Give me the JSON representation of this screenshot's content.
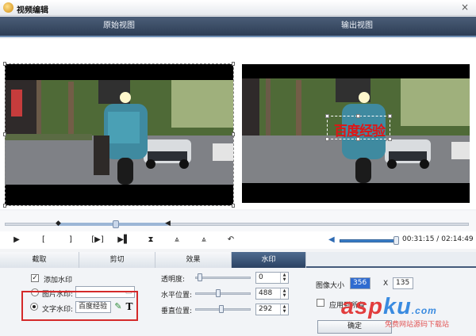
{
  "window": {
    "title": "视频编辑",
    "close_glyph": "×"
  },
  "preview": {
    "original_label": "原始视图",
    "output_label": "输出视图",
    "watermark_text": "百度经验"
  },
  "playback": {
    "buttons": [
      "▶",
      "[",
      "]",
      "[▶]",
      "▶▌",
      "⧗",
      "⩓",
      "⩓",
      "↶"
    ],
    "time_current": "00:31:15",
    "time_separator": "/",
    "time_total": "02:14:49",
    "volume_level": 0.9
  },
  "tabs": [
    {
      "label": "截取",
      "active": false
    },
    {
      "label": "剪切",
      "active": false
    },
    {
      "label": "效果",
      "active": false
    },
    {
      "label": "水印",
      "active": true
    }
  ],
  "watermark_panel": {
    "add_watermark": {
      "label": "添加水印",
      "checked": true
    },
    "image_watermark": {
      "label": "图片水印:",
      "selected": false,
      "value": ""
    },
    "text_watermark": {
      "label": "文字水印:",
      "selected": true,
      "value": "百度经验"
    },
    "transparency": {
      "label": "透明度:",
      "value": "0"
    },
    "horizontal": {
      "label": "水平位置:",
      "value": "488"
    },
    "vertical": {
      "label": "垂直位置:",
      "value": "292"
    },
    "image_size": {
      "label": "图像大小",
      "width": "356",
      "x": "X",
      "height": "135"
    },
    "apply_all": {
      "label": "应用到所有",
      "checked": false
    },
    "ok_button": "确定"
  },
  "brand_overlay": {
    "main": "aspku",
    "main_a": "asp",
    "main_b": "ku",
    "domain": ".com",
    "sub": "免费网站源码下载站"
  },
  "colors": {
    "header": "#2d3d55",
    "active_tab": "#2b4263",
    "highlight": "#d42a2a",
    "watermark": "#e01515"
  }
}
